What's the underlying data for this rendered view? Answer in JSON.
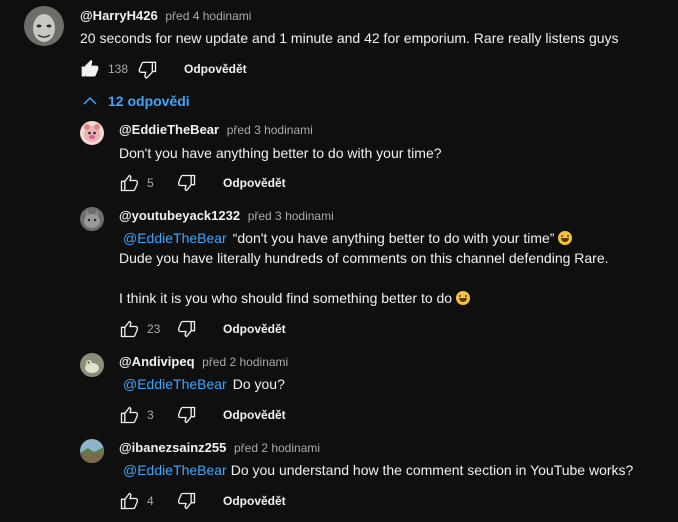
{
  "main_comment": {
    "author": "@HarryH426",
    "time": "před 4 hodinami",
    "text": "20 seconds for new update and 1 minute and 42 for emporium. Rare really listens guys",
    "likes": "138",
    "reply_label": "Odpovědět"
  },
  "replies_toggle": {
    "label": "12 odpovědi"
  },
  "replies": [
    {
      "author": "@EddieTheBear",
      "time": "před 3 hodinami",
      "text": "Don't you have anything better to do with your time?",
      "likes": "5",
      "reply_label": "Odpovědět"
    },
    {
      "author": "@youtubeyack1232",
      "time": "před 3 hodinami",
      "mention": "@EddieTheBear",
      "text_line1": "“don't you have anything better to do with your time”",
      "text_line2": "Dude you have literally hundreds of comments on this channel defending Rare.",
      "text_line3": "I think it is you who should find something better to do",
      "likes": "23",
      "reply_label": "Odpovědět"
    },
    {
      "author": "@Andivipeq",
      "time": "před 2 hodinami",
      "mention": "@EddieTheBear",
      "text": "Do you?",
      "likes": "3",
      "reply_label": "Odpovědět"
    },
    {
      "author": "@ibanezsainz255",
      "time": "před 2 hodinami",
      "mention": "@EddieTheBear",
      "text": "Do you understand how  the comment section in YouTube works?",
      "likes": "4",
      "reply_label": "Odpovědět"
    }
  ],
  "colors": {
    "background": "#0f0f0f",
    "link": "#3ea6ff",
    "text": "#f1f1f1",
    "muted": "#aaaaaa"
  },
  "icons": [
    "like-icon",
    "dislike-icon",
    "chevron-up-icon",
    "laughing-emoji-icon",
    "grinning-emoji-icon"
  ]
}
